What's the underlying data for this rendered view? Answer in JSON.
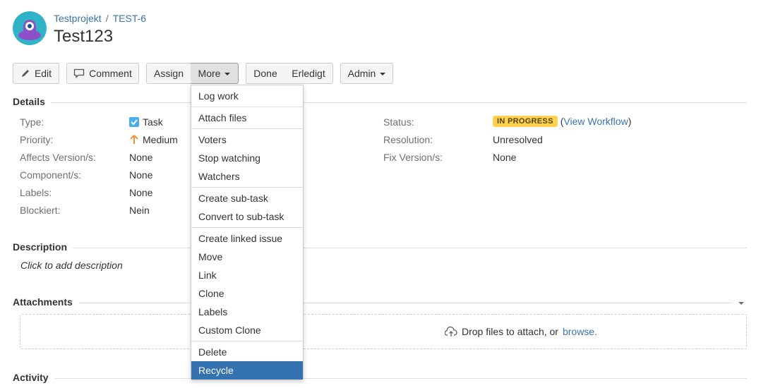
{
  "header": {
    "project": "Testprojekt",
    "separator": "/",
    "issue_key": "TEST-6",
    "title": "Test123"
  },
  "toolbar": {
    "edit": "Edit",
    "comment": "Comment",
    "assign": "Assign",
    "more": "More",
    "done": "Done",
    "erledigt": "Erledigt",
    "admin": "Admin"
  },
  "sections": {
    "details": "Details",
    "description": "Description",
    "attachments": "Attachments",
    "activity": "Activity"
  },
  "details": {
    "type_label": "Type:",
    "type_value": "Task",
    "priority_label": "Priority:",
    "priority_value": "Medium",
    "affects_label": "Affects Version/s:",
    "affects_value": "None",
    "component_label": "Component/s:",
    "component_value": "None",
    "labels_label": "Labels:",
    "labels_value": "None",
    "blockiert_label": "Blockiert:",
    "blockiert_value": "Nein",
    "status_label": "Status:",
    "status_value": "IN PROGRESS",
    "view_workflow_open": "(",
    "view_workflow": "View Workflow",
    "view_workflow_close": ")",
    "resolution_label": "Resolution:",
    "resolution_value": "Unresolved",
    "fix_label": "Fix Version/s:",
    "fix_value": "None"
  },
  "description": {
    "placeholder": "Click to add description"
  },
  "attachments": {
    "drop_text": "Drop files to attach, or",
    "browse": "browse."
  },
  "more_menu": {
    "items": [
      "Log work",
      "Attach files",
      "Voters",
      "Stop watching",
      "Watchers",
      "Create sub-task",
      "Convert to sub-task",
      "Create linked issue",
      "Move",
      "Link",
      "Clone",
      "Labels",
      "Custom Clone",
      "Delete",
      "Recycle"
    ],
    "selected": "Recycle"
  },
  "colors": {
    "link": "#3b73af",
    "status_lozenge": "#ffd351",
    "selected_item": "#3572b0",
    "priority_arrow": "#f79232",
    "task_checkbox": "#4bade8"
  }
}
